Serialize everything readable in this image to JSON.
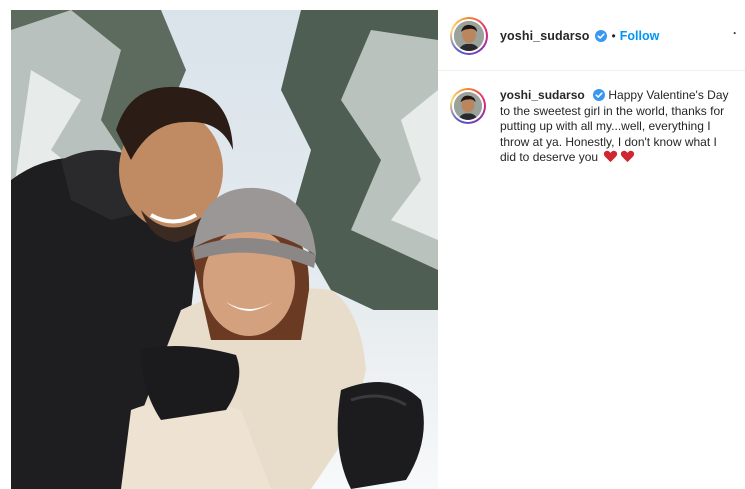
{
  "post": {
    "photo_icon": "post-photo",
    "photo_alt": "Couple hugging in a snowy forest"
  },
  "header": {
    "username": "yoshi_sudarso",
    "separator": "•",
    "follow_label": "Follow",
    "more_label": "·"
  },
  "caption": {
    "username": "yoshi_sudarso",
    "text": "Happy Valentine's Day to the sweetest girl in the world, thanks for putting up with all my...well, everything I throw at ya. Honestly, I don't know what I did to deserve you",
    "emoji_icons": [
      "heart-icon",
      "heart-icon"
    ]
  },
  "colors": {
    "follow": "#0095f6",
    "verified": "#3897f0",
    "heart": "#d0262f"
  }
}
